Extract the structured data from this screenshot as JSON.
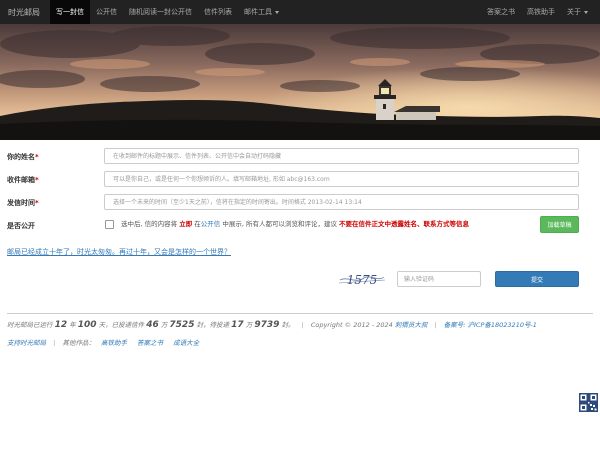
{
  "nav": {
    "brand": "时光邮局",
    "items": [
      {
        "label": "写一封信",
        "active": true
      },
      {
        "label": "公开信"
      },
      {
        "label": "随机阅读一封公开信"
      },
      {
        "label": "信件列表"
      },
      {
        "label": "邮件工具"
      }
    ],
    "right_items": [
      {
        "label": "答案之书"
      },
      {
        "label": "高铁助手"
      },
      {
        "label": "关于"
      }
    ]
  },
  "form": {
    "name_label": "你的姓名",
    "name_placeholder": "在收到邮件的标题中展示、信件列表、公开信中会自动打码隐藏",
    "email_label": "收件邮箱",
    "email_placeholder": "可以是你自己，或是任何一个你想倾诉的人。填写邮箱地址, 形如 abc@163.com",
    "time_label": "发信时间",
    "time_placeholder": "选择一个未来的时间（至少1天之前），信将在指定的时间寄出。时间格式 2013-02-14 13:14",
    "public_label": "是否公开",
    "public_note": {
      "p1": "选中后, 信的内容将 ",
      "p2": "立即",
      "p3": " 在",
      "p4": "公开信",
      "p5": " 中展示, 所有人都可以浏览和评论，建议 ",
      "p6": "不要在信件正文中透露姓名、联系方式等信息"
    },
    "draft_button": "加载草稿",
    "teaser": "邮局已经成立十年了，时光太匆匆。再过十年，又会是怎样的一个世界？",
    "captcha_text": "1575",
    "captcha_placeholder": "输入验证码",
    "submit_button": "提交"
  },
  "footer": {
    "line1": {
      "p1": "时光邮局已运行",
      "years": "12",
      "p2": "年",
      "days": "100",
      "p3": "天，已投递信件",
      "sent_wan": "46",
      "p4": "万",
      "sent_rest": "7525",
      "p5": "封，待投递",
      "pending_wan": "17",
      "p6": "万",
      "pending_rest": "9739",
      "p7": "封。",
      "copyright": "Copyright © 2012 - 2024",
      "author": "刺猬员大叔",
      "icp_label": "备案号:",
      "icp": "沪ICP备18023210号-1"
    },
    "line2": {
      "support": "支持时光邮局",
      "others": "其他作品：",
      "links": [
        "高铁助手",
        "答案之书",
        "成语大全"
      ]
    }
  },
  "colors": {
    "navbar": "#222222",
    "link": "#337ab7",
    "primary": "#337ab7",
    "success": "#5cb85c",
    "danger": "#cc0000"
  },
  "icons": {
    "qr": "qr-code-icon",
    "caret": "caret-down-icon"
  }
}
